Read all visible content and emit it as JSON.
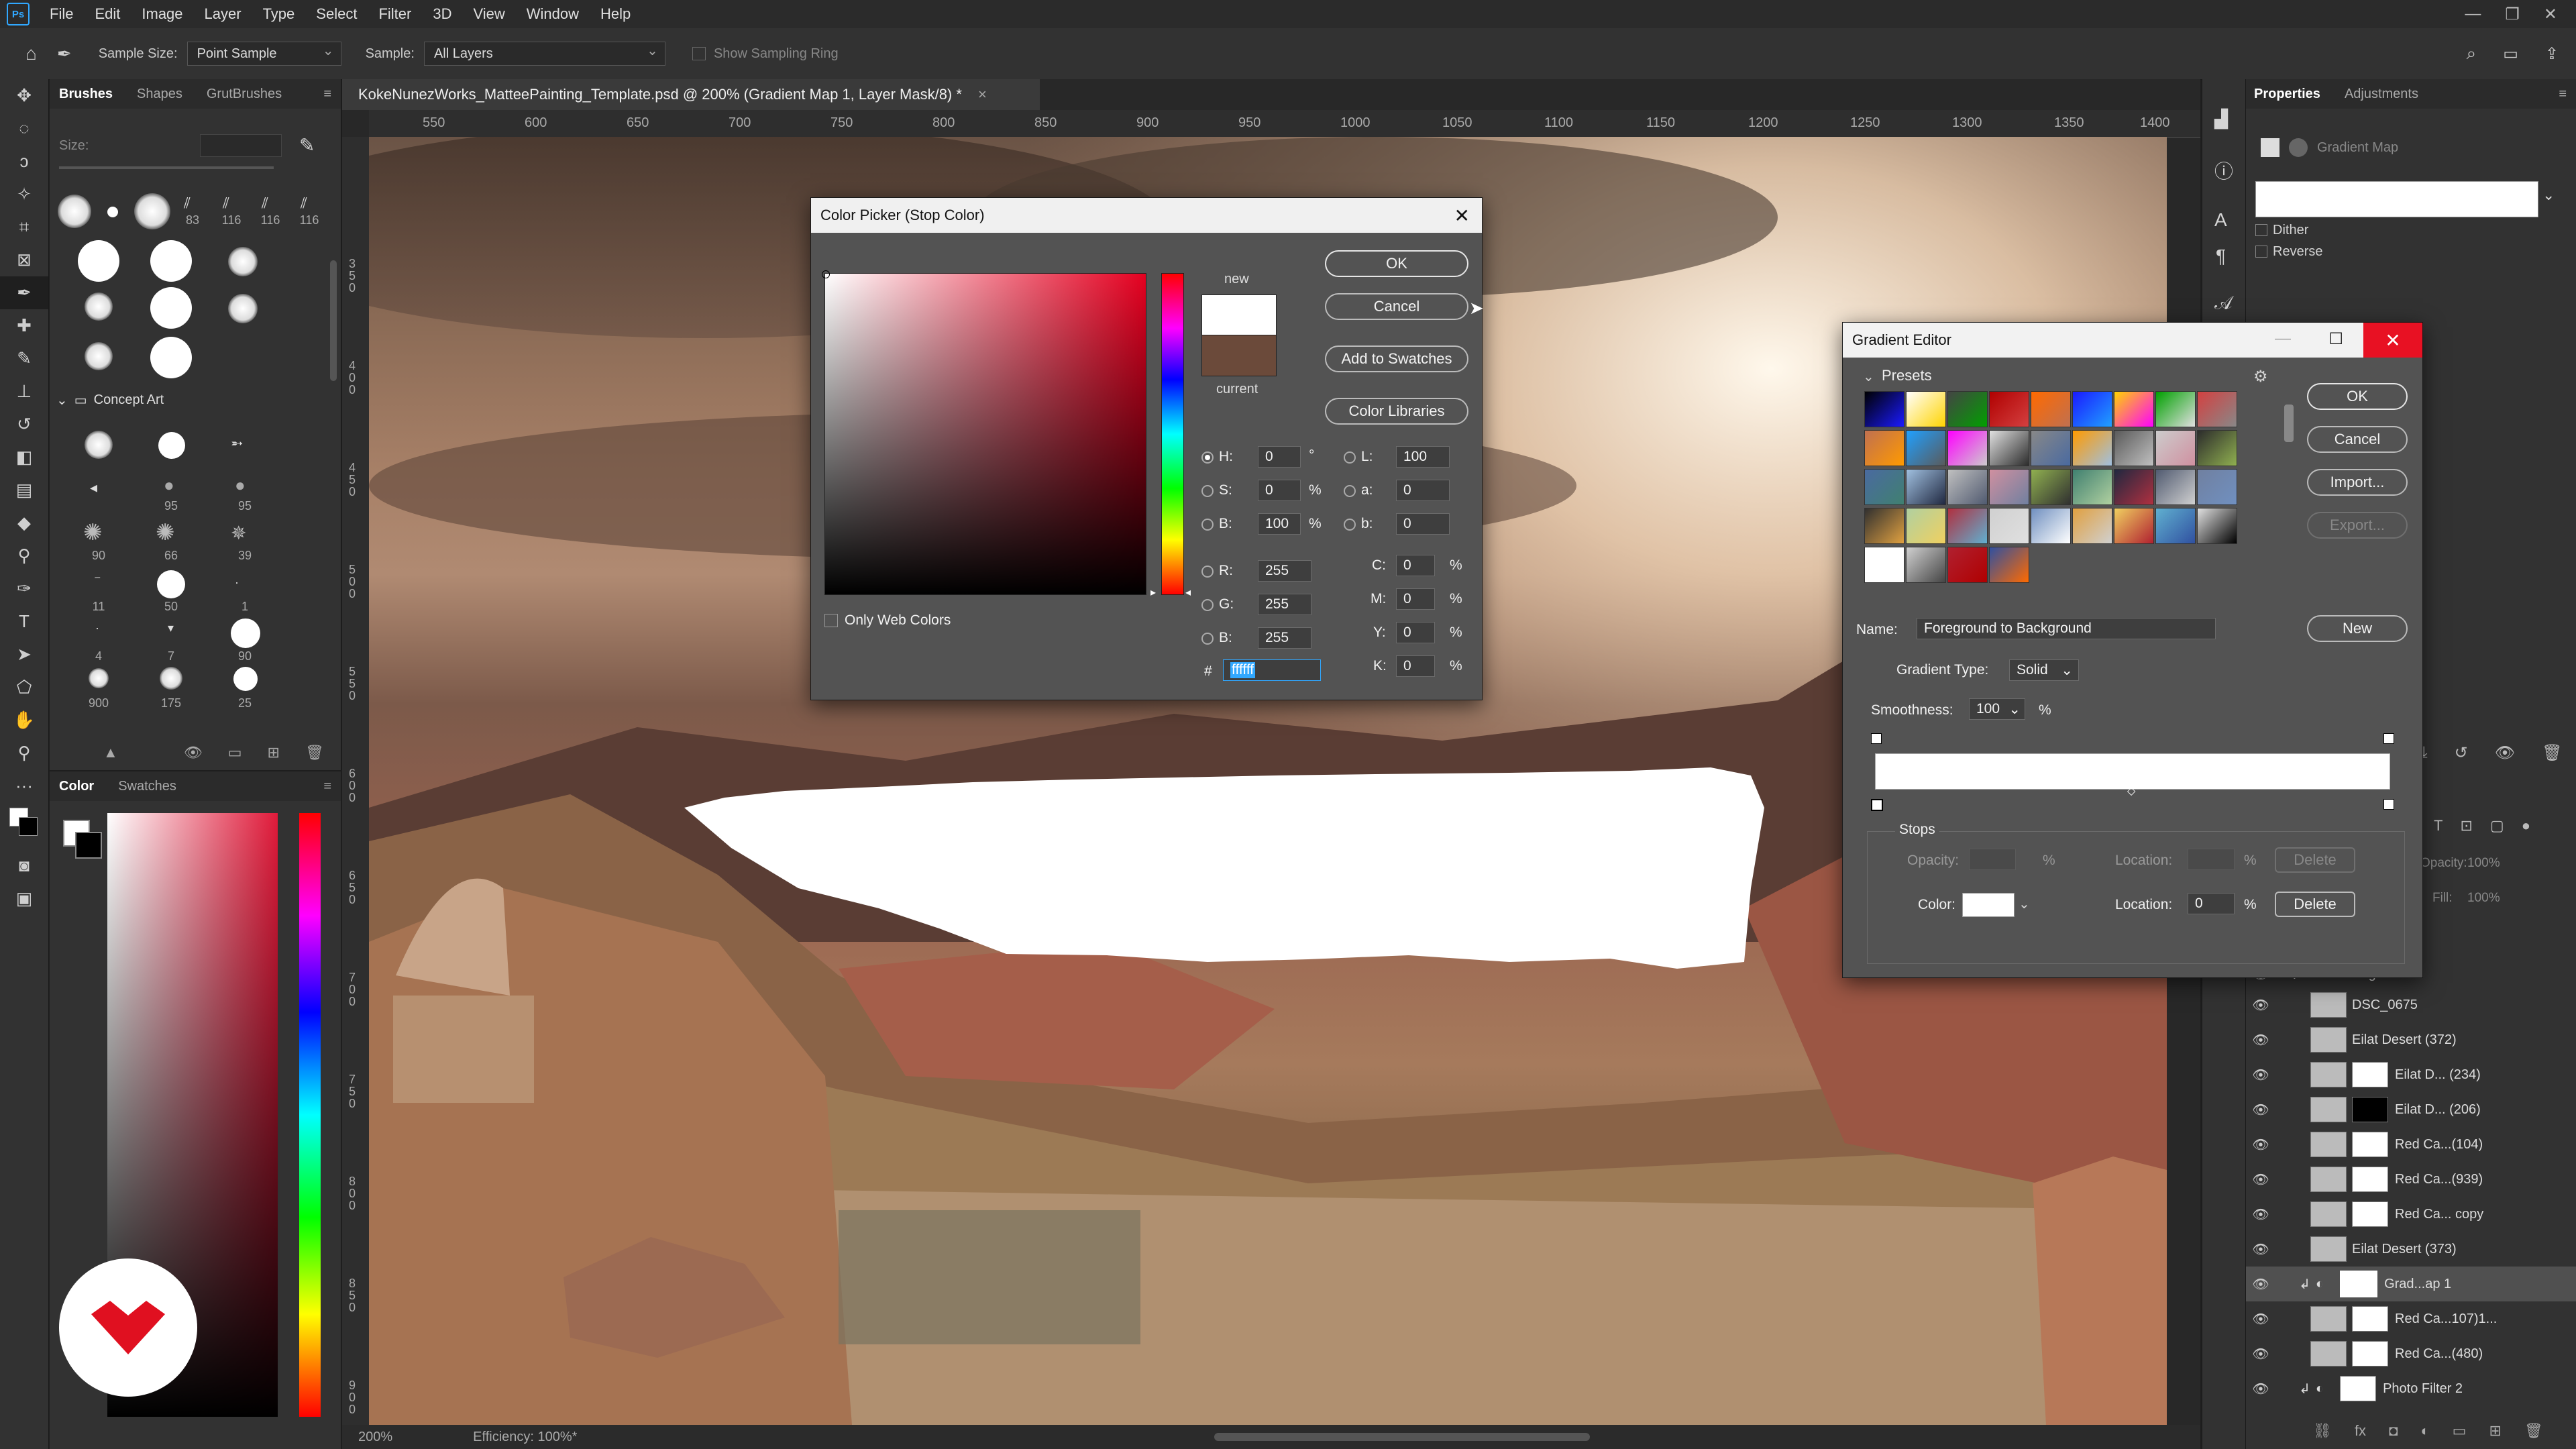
{
  "menubar": {
    "logo": "Ps",
    "items": [
      "File",
      "Edit",
      "Image",
      "Layer",
      "Type",
      "Select",
      "Filter",
      "3D",
      "View",
      "Window",
      "Help"
    ]
  },
  "optionsbar": {
    "sample_size_label": "Sample Size:",
    "sample_size_value": "Point Sample",
    "sample_label": "Sample:",
    "sample_value": "All Layers",
    "sampling_ring_label": "Show Sampling Ring"
  },
  "brushes_panel": {
    "tabs": [
      "Brushes",
      "Shapes",
      "GrutBrushes"
    ],
    "size_label": "Size:",
    "recent_numbers": [
      "83",
      "116",
      "116",
      "116"
    ],
    "folder": "Concept Art",
    "numbers": [
      "95",
      "95",
      "90",
      "66",
      "39",
      "11",
      "50",
      "1",
      "4",
      "7",
      "90",
      "900",
      "175",
      "25"
    ]
  },
  "color_panel": {
    "tabs": [
      "Color",
      "Swatches"
    ]
  },
  "document": {
    "tab_title": "KokeNunezWorks_MatteePainting_Template.psd @ 200% (Gradient Map 1, Layer Mask/8) *",
    "ruler_h": [
      "550",
      "600",
      "650",
      "700",
      "750",
      "800",
      "850",
      "900",
      "950",
      "1000",
      "1050",
      "1100",
      "1150",
      "1200",
      "1250",
      "1300",
      "1350",
      "1400"
    ],
    "ruler_v": [
      "350",
      "400",
      "450",
      "500",
      "550",
      "600",
      "650",
      "700",
      "750",
      "800",
      "850",
      "900"
    ],
    "zoom": "200%",
    "efficiency": "Efficiency: 100%*"
  },
  "color_picker": {
    "title": "Color Picker (Stop Color)",
    "ok": "OK",
    "cancel": "Cancel",
    "add_to_swatches": "Add to Swatches",
    "color_libraries": "Color Libraries",
    "new_label": "new",
    "current_label": "current",
    "new_color": "#ffffff",
    "current_color": "#6b4a3a",
    "only_web_colors": "Only Web Colors",
    "hsb": {
      "h_label": "H:",
      "h": "0",
      "h_unit": "°",
      "s_label": "S:",
      "s": "0",
      "s_unit": "%",
      "b_label": "B:",
      "b": "100",
      "b_unit": "%"
    },
    "rgb": {
      "r_label": "R:",
      "r": "255",
      "g_label": "G:",
      "g": "255",
      "b_label": "B:",
      "b": "255"
    },
    "lab": {
      "l_label": "L:",
      "l": "100",
      "a_label": "a:",
      "a": "0",
      "b_label": "b:",
      "b": "0"
    },
    "cmyk": {
      "c_label": "C:",
      "c": "0",
      "m_label": "M:",
      "m": "0",
      "y_label": "Y:",
      "y": "0",
      "k_label": "K:",
      "k": "0",
      "unit": "%"
    },
    "hex_label": "#",
    "hex": "ffffff"
  },
  "gradient_editor": {
    "title": "Gradient Editor",
    "presets_label": "Presets",
    "ok": "OK",
    "cancel": "Cancel",
    "import": "Import...",
    "export": "Export...",
    "new": "New",
    "name_label": "Name:",
    "name_value": "Foreground to Background",
    "gradient_type_label": "Gradient Type:",
    "gradient_type_value": "Solid",
    "smoothness_label": "Smoothness:",
    "smoothness_value": "100",
    "smoothness_unit": "%",
    "stops_label": "Stops",
    "opacity_label": "Opacity:",
    "location_label": "Location:",
    "pct": "%",
    "delete": "Delete",
    "color_label": "Color:",
    "color_location_value": "0",
    "preset_colors": [
      "#000000",
      "#ffffff",
      "#444444",
      "#b00000",
      "#ff6a00",
      "#1a1aff",
      "#ffd400",
      "#00a000",
      "#d44040",
      "#c07050",
      "#20a0ff",
      "#ff00ff",
      "#e0e0e0",
      "#888888",
      "#ff9a00",
      "#5a5a5a",
      "#cccccc",
      "#2c2c2c",
      "#4a6aa0",
      "#a0c0e0",
      "#c0c0c0",
      "#d090a0",
      "#90b050",
      "#408070",
      "#202840",
      "#505a70",
      "#7080a0",
      "#303030",
      "#b0d0a0",
      "#b03040",
      "#d0d0d0",
      "#7090c0",
      "#e0a040",
      "#f0d060",
      "#60b0d0",
      "#e0e0e0",
      "#ffffff",
      "#d0d0d0",
      "#b02030",
      "#3050a0"
    ]
  },
  "properties_panel": {
    "tabs": [
      "Properties",
      "Adjustments"
    ],
    "gradient_map_label": "Gradient Map",
    "dither": "Dither",
    "reverse": "Reverse"
  },
  "layers_panel": {
    "opacity_label": "Opacity:",
    "opacity_value": "100%",
    "fill_label": "Fill:",
    "fill_value": "100%",
    "group": "middleground",
    "layers": [
      "DSC_0675",
      "Eilat Desert (372)",
      "Eilat D... (234)",
      "Eilat D... (206)",
      "Red Ca...(104)",
      "Red Ca...(939)",
      "Red Ca... copy",
      "Eilat Desert (373)",
      "Grad...ap 1",
      "Red Ca...107)1...",
      "Red Ca...(480)",
      "Photo Filter 2"
    ]
  },
  "colors": {
    "accent": "#31a8ff",
    "panel": "#323232",
    "dialog": "#535353",
    "close_red": "#e81123"
  }
}
